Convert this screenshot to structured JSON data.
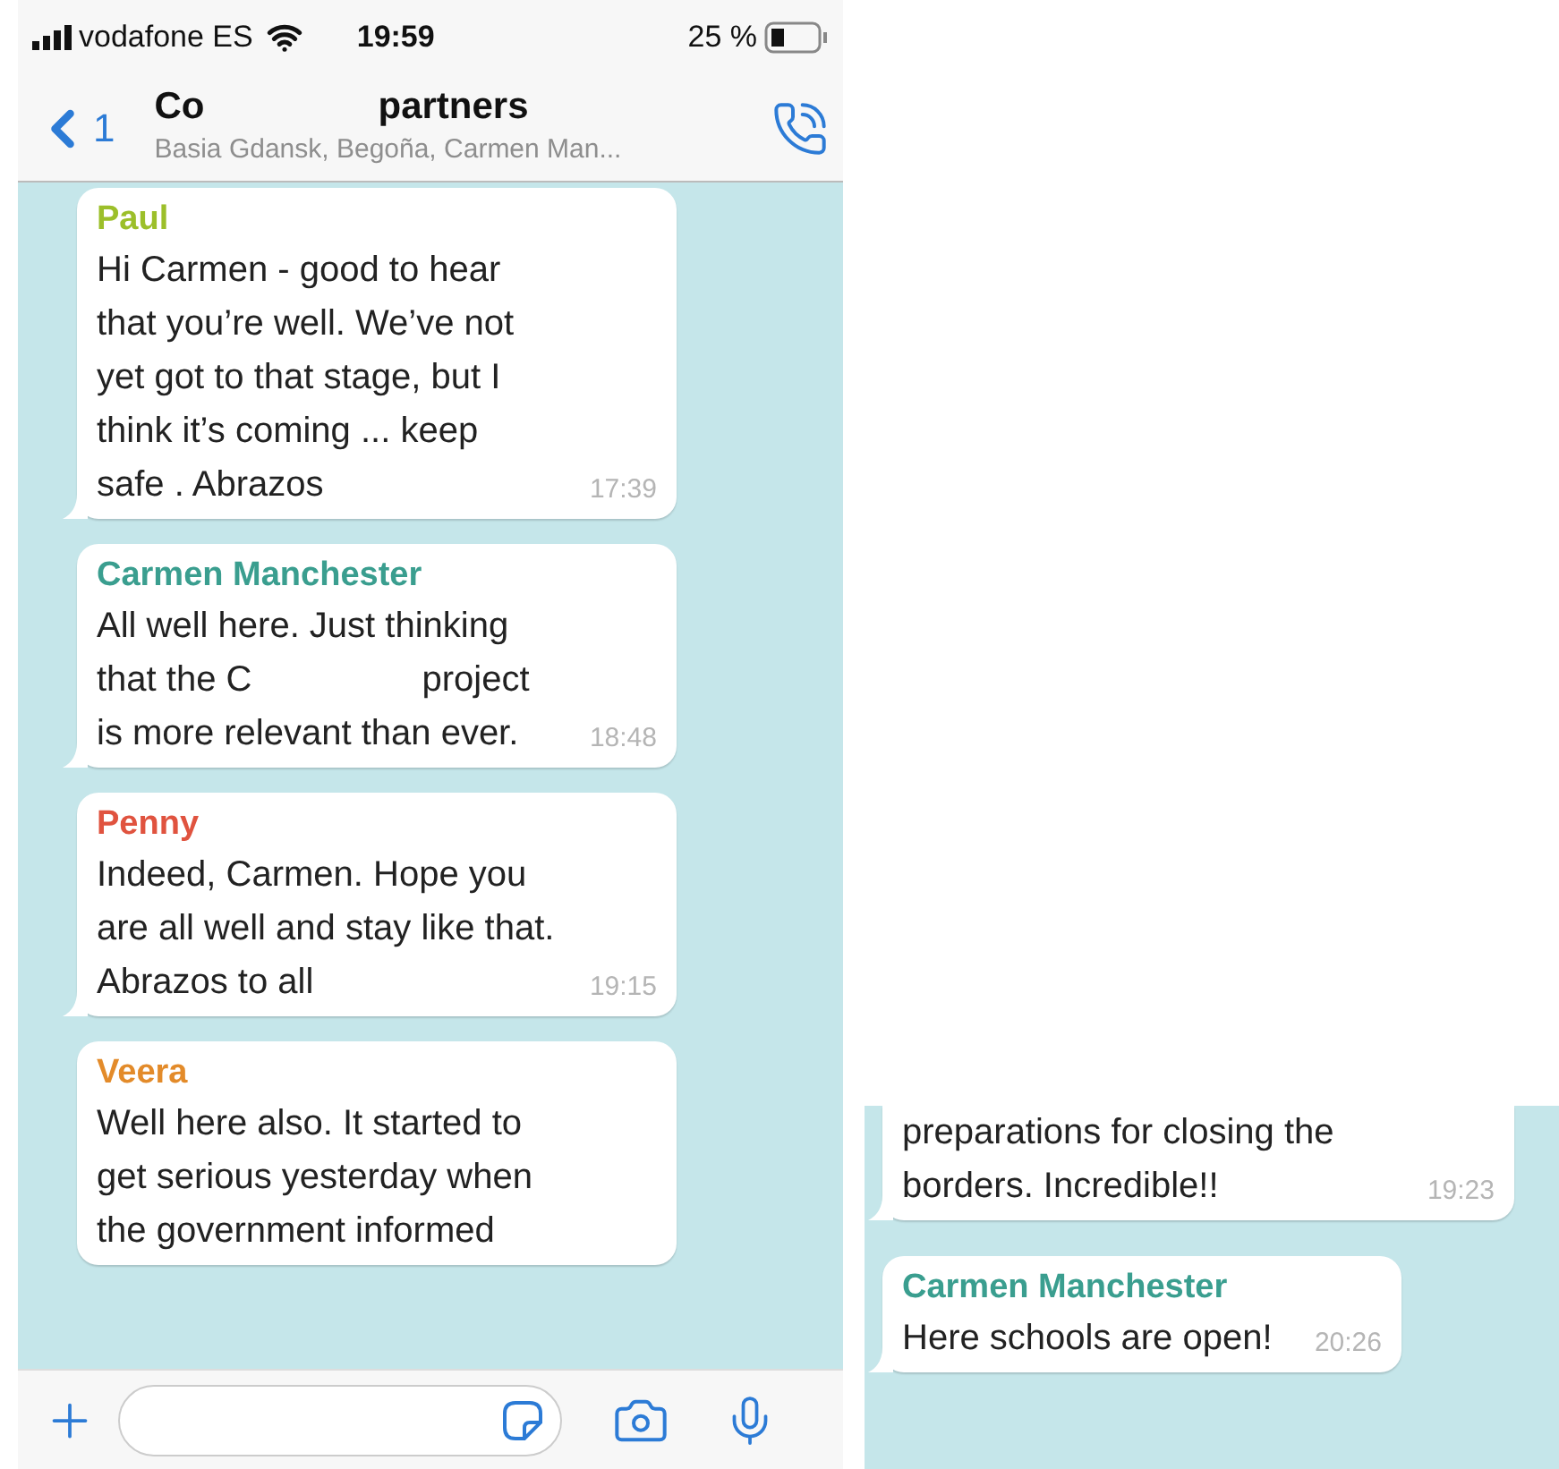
{
  "status_bar": {
    "carrier": "vodafone ES",
    "time": "19:59",
    "battery": "25 %"
  },
  "header": {
    "back_count": "1",
    "title_parts": [
      "Co",
      "partners"
    ],
    "subtitle": "Basia Gdansk, Begoña, Carmen Man..."
  },
  "panels": [
    {
      "messages": [
        {
          "sender": "Paul",
          "color": "#9cbf2a",
          "lines": [
            "Hi Carmen - good to hear",
            "that you’re well. We’ve not",
            "yet got to that stage, but I",
            "think it’s coming ... keep",
            "safe . Abrazos"
          ],
          "time": "17:39"
        },
        {
          "sender": "Carmen Manchester",
          "color": "#3a9e8f",
          "lines": [
            "All well here. Just thinking",
            [
              "that the C",
              "project"
            ],
            "is more relevant than ever."
          ],
          "time": "18:48"
        },
        {
          "sender": "Penny",
          "color": "#e0533f",
          "lines": [
            "Indeed, Carmen. Hope you",
            "are all well and stay like that.",
            "Abrazos to all"
          ],
          "time": "19:15"
        },
        {
          "sender": "Veera",
          "color": "#e38b2a",
          "lines": [
            "Well here also. It started to",
            "get serious yesterday when",
            "the government informed"
          ]
        }
      ]
    },
    {
      "messages": [
        {
          "lines": [
            "preparations for closing the",
            "borders. Incredible!!"
          ],
          "time": "19:23"
        },
        {
          "sender": "Carmen Manchester",
          "color": "#3a9e8f",
          "lines": [
            "Here schools are open!"
          ],
          "time": "20:26"
        }
      ]
    }
  ]
}
